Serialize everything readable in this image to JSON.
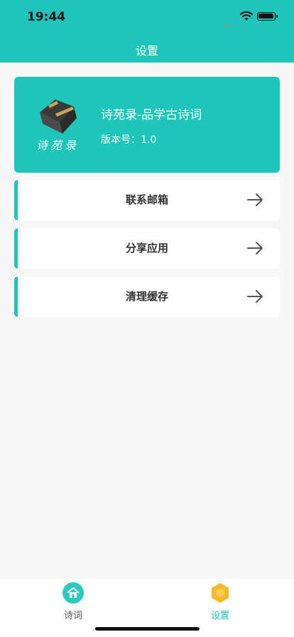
{
  "status_bar": {
    "time": "19:44"
  },
  "nav": {
    "title": "设置"
  },
  "app_card": {
    "logo_text": "诗苑录",
    "name": "诗苑录-品学古诗词",
    "version": "版本号：1.0"
  },
  "menu": [
    {
      "label": "联系邮箱",
      "icon": "arrow-right-icon"
    },
    {
      "label": "分享应用",
      "icon": "arrow-right-icon"
    },
    {
      "label": "清理缓存",
      "icon": "arrow-right-icon"
    }
  ],
  "tabbar": {
    "tabs": [
      {
        "label": "诗词",
        "icon": "home-icon",
        "active": false
      },
      {
        "label": "设置",
        "icon": "hexagon-settings-icon",
        "active": true
      }
    ]
  },
  "colors": {
    "accent": "#1ec6b9",
    "active_tab": "#1ec6b9",
    "inactive_tab": "#555555",
    "settings_icon": "#f5b92a"
  }
}
